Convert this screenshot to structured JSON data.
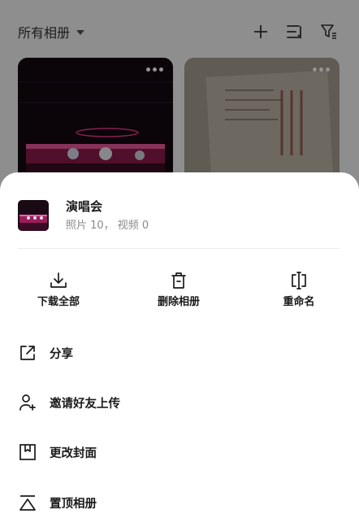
{
  "background": {
    "album_selector": {
      "label": "所有相册",
      "icon": "caret-down-icon"
    },
    "toolbar_icons": [
      "plus-icon",
      "sort-icon",
      "filter-icon"
    ],
    "cards": [
      {
        "more_icon": "more-dots-icon"
      },
      {
        "more_icon": "more-dots-icon"
      }
    ]
  },
  "sheet": {
    "album": {
      "name": "演唱会",
      "photos": "照片 10，",
      "videos": "视频 0"
    },
    "quick_actions": [
      {
        "label": "下载全部",
        "icon": "download-icon"
      },
      {
        "label": "删除相册",
        "icon": "trash-icon"
      },
      {
        "label": "重命名",
        "icon": "rename-icon"
      }
    ],
    "menu": [
      {
        "label": "分享",
        "icon": "share-icon"
      },
      {
        "label": "邀请好友上传",
        "icon": "invite-user-icon"
      },
      {
        "label": "更改封面",
        "icon": "cover-icon"
      },
      {
        "label": "置顶相册",
        "icon": "pin-top-icon"
      }
    ]
  },
  "colors": {
    "overlay": "#000000",
    "sheet_bg": "#ffffff",
    "primary_text": "#1a1a1a",
    "secondary_text": "#8a8a8a"
  }
}
